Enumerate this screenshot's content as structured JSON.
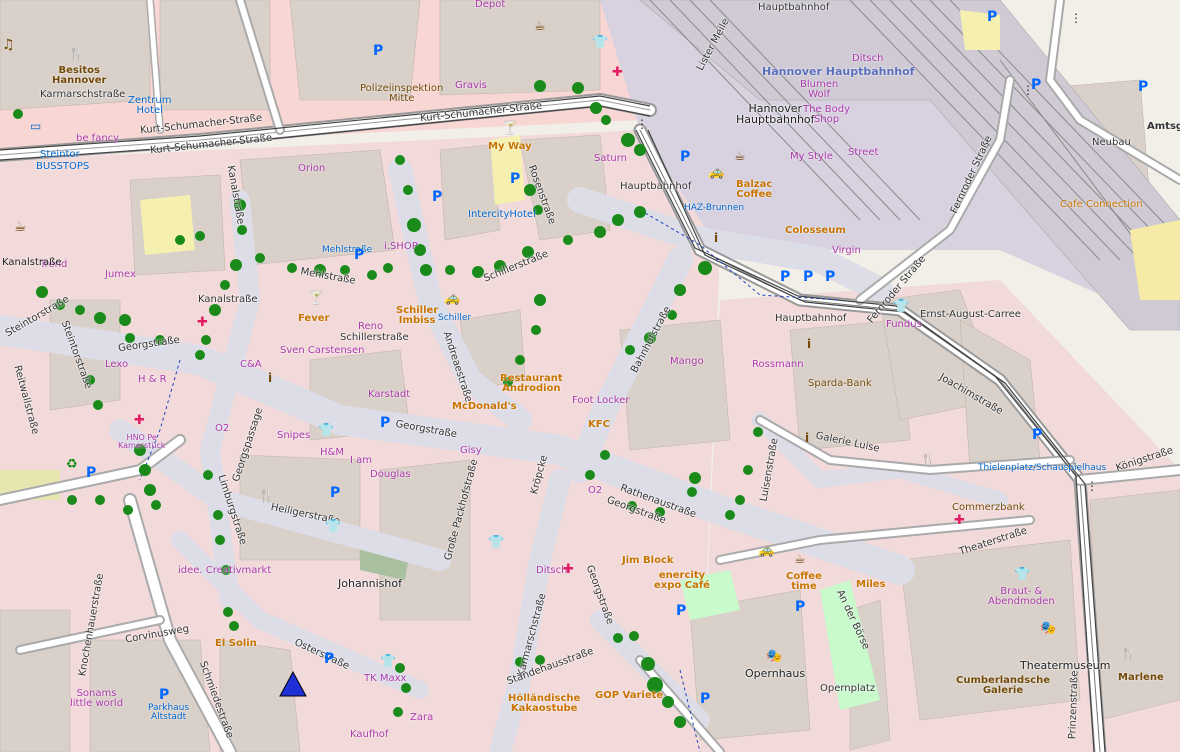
{
  "map": {
    "city": "Hannover",
    "streets": [
      "Kurt-Schumacher-Straße",
      "Kurt-Schumacher-Straße",
      "Kurt-Schumacher-Straße",
      "Steintorstraße",
      "Georgstraße",
      "Georgstraße",
      "Georgstraße",
      "Karmarschstraße",
      "Kanalstraße",
      "Mehlstraße",
      "Schillerstraße",
      "Schillerstraße",
      "Andreaestraße",
      "Bahnhofstraße",
      "Rosenstraße",
      "Lister Meile",
      "Fernroder Straße",
      "Fernroder Straße",
      "Ernst-August-Carree",
      "Joachimstraße",
      "Luisenstraße",
      "Galerie Luise",
      "Theaterstraße",
      "Königstraße",
      "Prinzenstraße",
      "An der Börse",
      "Opernplatz",
      "Rathenaustraße",
      "Georgstraße",
      "Große Packhofstraße",
      "Kröpcke",
      "Heiligerstraße",
      "Limburgstraße",
      "Georgspassage",
      "Osterstraße",
      "Corvinusweg",
      "Schmiedestraße",
      "Knochenhauerstraße",
      "Reitwallstraße",
      "Steintorstraße",
      "Standehausstraße",
      "Kanalstraße",
      "Karmarschstraße",
      "Hauptbahnhof",
      "Hauptbahnhof",
      "Hauptbahnhof",
      "Neubau",
      "Amtsg"
    ],
    "places": {
      "station": "Hannover Hauptbahnhof",
      "station_alt": "Hannover\nHauptbahnhof",
      "steintor": "Steintor",
      "busstops": "BUSSTOPS",
      "johannishof": "Johannishof",
      "ernst": "Ernst-August-Carree",
      "opernhaus": "Opernhaus",
      "theatermuseum": "Theatermuseum",
      "galerie_luise": "Galerie Luise"
    },
    "pois": [
      "Besitos\nHannover",
      "Zentrum\nHotel",
      "be fancy",
      "Polizeiinspektion\nMitte",
      "Gravis",
      "Depot",
      "My Way",
      "Saturn",
      "IntercityHotel",
      "Mehlstraße",
      "i.SHOP",
      "Orion",
      "Trend",
      "Jumex",
      "Fever",
      "Reno",
      "Sven Carstensen",
      "Schiller\nImbiss",
      "Schiller",
      "Restaurant\nAndrodion",
      "McDonald's",
      "Lexo",
      "H & R",
      "C&A",
      "HNO Pe\nKamerstück",
      "O2",
      "Snipes",
      "H&M",
      "I am",
      "Douglas",
      "Karstadt",
      "Gisy",
      "Foot Locker",
      "KFC",
      "O2",
      "Mango",
      "Balzac\nCoffee",
      "Colosseum",
      "Virgin",
      "HAZ-Brunnen",
      "Blumen\nWolf",
      "The Body\nShop",
      "Ditsch",
      "My Style",
      "Street",
      "Rossmann",
      "Sparda-Bank",
      "Thielenplatz/Schauspielhaus",
      "Commerzbank",
      "Cafe Connection",
      "Jim Block",
      "enercity\nexpo Café",
      "Coffee\ntime",
      "Miles",
      "Braut- &\nAbendmoden",
      "Cumberlandsche\nGalerie",
      "Marlene",
      "idee. Creativmarkt",
      "El Solin",
      "TK Maxx",
      "Zara",
      "Kaufhof",
      "Hölländische\nKakaostube",
      "GOP Variete",
      "Parkhaus\nAltstadt",
      "Sonams\nlittle world",
      "Ditsch",
      "Fundus",
      "Kanalstraße"
    ]
  },
  "colors": {
    "background": "#f2efe9",
    "building": "#d9d0c9",
    "pedestrian": "#dddde8",
    "retail": "#ffd6d1",
    "road_major": "#ffffff",
    "rail": "#999999",
    "tree": "#1a7f1a",
    "park": "#c8facc",
    "parking": "#eeeeee",
    "marker": "#1e2fd6"
  }
}
